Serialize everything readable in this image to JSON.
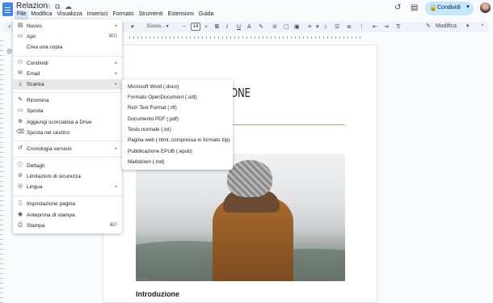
{
  "document": {
    "title": "Relazion",
    "heading_visible": "ONE",
    "section_heading": "Introduzione"
  },
  "menubar": [
    "File",
    "Modifica",
    "Visualizza",
    "Inserisci",
    "Formato",
    "Strumenti",
    "Estensioni",
    "Guida"
  ],
  "header": {
    "share_label": "Condividi"
  },
  "toolbar": {
    "font": "Econo...",
    "font_size": "14",
    "mode": "Modifica"
  },
  "file_menu": {
    "items": [
      {
        "label": "Nuovo",
        "icon": "new-doc-icon",
        "glyph": "▤",
        "arrow": "▸",
        "shortcut": ""
      },
      {
        "label": "Apri",
        "icon": "folder-icon",
        "glyph": "▭",
        "arrow": "",
        "shortcut": "⌘O"
      },
      {
        "label": "Crea una copia",
        "icon": "copy-icon",
        "glyph": "",
        "arrow": "",
        "shortcut": ""
      },
      {
        "label": "Condividi",
        "icon": "person-add-icon",
        "glyph": "⚇",
        "arrow": "▸",
        "shortcut": ""
      },
      {
        "label": "Email",
        "icon": "mail-icon",
        "glyph": "✉",
        "arrow": "▸",
        "shortcut": ""
      },
      {
        "label": "Scarica",
        "icon": "download-icon",
        "glyph": "⤓",
        "arrow": "▸",
        "shortcut": ""
      },
      {
        "label": "Rinomina",
        "icon": "rename-icon",
        "glyph": "✎",
        "arrow": "",
        "shortcut": ""
      },
      {
        "label": "Sposta",
        "icon": "move-folder-icon",
        "glyph": "▭",
        "arrow": "",
        "shortcut": ""
      },
      {
        "label": "Aggiungi scorciatoia a Drive",
        "icon": "drive-shortcut-icon",
        "glyph": "⊕",
        "arrow": "",
        "shortcut": ""
      },
      {
        "label": "Sposta nel cestino",
        "icon": "trash-icon",
        "glyph": "⌫",
        "arrow": "",
        "shortcut": ""
      },
      {
        "label": "Cronologia versioni",
        "icon": "history-icon",
        "glyph": "↺",
        "arrow": "▸",
        "shortcut": ""
      },
      {
        "label": "Dettagli",
        "icon": "info-icon",
        "glyph": "ⓘ",
        "arrow": "",
        "shortcut": ""
      },
      {
        "label": "Limitazioni di sicurezza",
        "icon": "security-icon",
        "glyph": "⊘",
        "arrow": "",
        "shortcut": ""
      },
      {
        "label": "Lingua",
        "icon": "globe-icon",
        "glyph": "◎",
        "arrow": "▸",
        "shortcut": ""
      },
      {
        "label": "Impostazione pagina",
        "icon": "page-setup-icon",
        "glyph": "▯",
        "arrow": "",
        "shortcut": ""
      },
      {
        "label": "Anteprima di stampa",
        "icon": "preview-icon",
        "glyph": "◉",
        "arrow": "",
        "shortcut": ""
      },
      {
        "label": "Stampa",
        "icon": "print-icon",
        "glyph": "⎙",
        "arrow": "",
        "shortcut": "⌘P"
      }
    ]
  },
  "download_submenu": {
    "items": [
      "Microsoft Word (.docx)",
      "Formato OpenDocument (.odt)",
      "Rich Text Format (.rtf)",
      "Documento PDF (.pdf)",
      "Testo normale (.txt)",
      "Pagina web (.html, compressa in formato zip)",
      "Pubblicazione EPUB (.epub)",
      "Markdown (.md)"
    ]
  },
  "colors": {
    "accent": "#c2e7ff",
    "highlight": "#e8e8e9",
    "rule": "#c7a67d"
  }
}
